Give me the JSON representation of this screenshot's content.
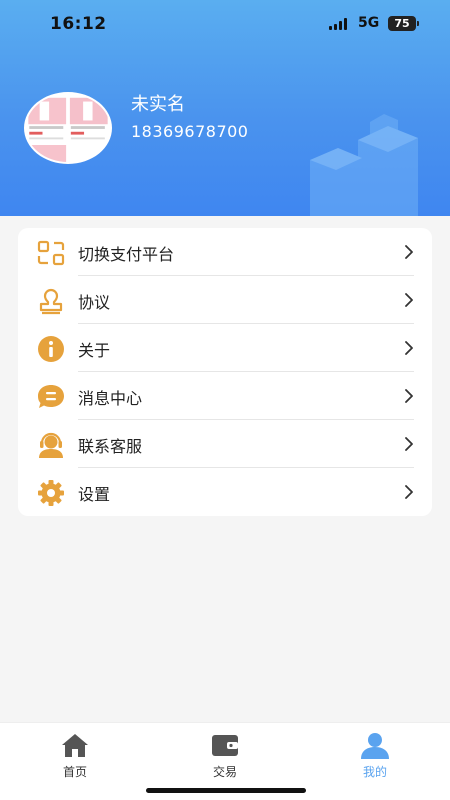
{
  "status_bar": {
    "time": "16:12",
    "network": "5G",
    "battery": "75"
  },
  "profile": {
    "name": "未实名",
    "phone": "18369678700"
  },
  "colors": {
    "header_blue": "#4a93ee",
    "icon_gold": "#e6a23c",
    "active_tab": "#4a93ee"
  },
  "menu": {
    "items": [
      {
        "label": "切换支付平台",
        "icon": "switch-platform-icon"
      },
      {
        "label": "协议",
        "icon": "agreement-icon"
      },
      {
        "label": "关于",
        "icon": "info-icon"
      },
      {
        "label": "消息中心",
        "icon": "message-icon"
      },
      {
        "label": "联系客服",
        "icon": "customer-service-icon"
      },
      {
        "label": "设置",
        "icon": "gear-icon"
      }
    ]
  },
  "tabbar": {
    "tabs": [
      {
        "label": "首页",
        "icon": "home-icon",
        "active": false
      },
      {
        "label": "交易",
        "icon": "wallet-icon",
        "active": false
      },
      {
        "label": "我的",
        "icon": "user-icon",
        "active": true
      }
    ]
  }
}
